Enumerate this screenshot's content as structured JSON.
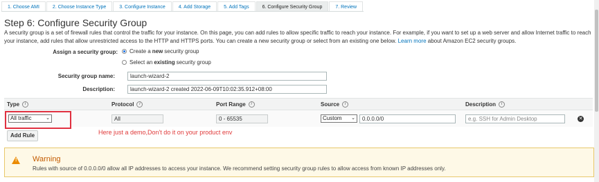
{
  "wizard_tabs": [
    {
      "label": "1. Choose AMI"
    },
    {
      "label": "2. Choose Instance Type"
    },
    {
      "label": "3. Configure Instance"
    },
    {
      "label": "4. Add Storage"
    },
    {
      "label": "5. Add Tags"
    },
    {
      "label": "6. Configure Security Group"
    },
    {
      "label": "7. Review"
    }
  ],
  "active_tab_index": 5,
  "step_title": "Step 6: Configure Security Group",
  "intro": {
    "text": "A security group is a set of firewall rules that control the traffic for your instance. On this page, you can add rules to allow specific traffic to reach your instance. For example, if you want to set up a web server and allow Internet traffic to reach your instance, add rules that allow unrestricted access to the HTTP and HTTPS ports. You can create a new security group or select from an existing one below.",
    "link": "Learn more",
    "suffix": "about Amazon EC2 security groups."
  },
  "assign": {
    "label": "Assign a security group:",
    "option_new_pre": "Create a",
    "option_new_bold": "new",
    "option_new_post": "security group",
    "option_existing_pre": "Select an",
    "option_existing_bold": "existing",
    "option_existing_post": "security group",
    "selected": "new"
  },
  "sg_name": {
    "label": "Security group name:",
    "value": "launch-wizard-2"
  },
  "description": {
    "label": "Description:",
    "value": "launch-wizard-2 created 2022-06-09T10:02:35.912+08:00"
  },
  "table": {
    "headers": {
      "type": "Type",
      "protocol": "Protocol",
      "port_range": "Port Range",
      "source": "Source",
      "description": "Description"
    },
    "info_glyph": "i",
    "rows": [
      {
        "type": "All traffic",
        "protocol": "All",
        "port_range": "0 - 65535",
        "source_mode": "Custom",
        "source_cidr": "0.0.0.0/0",
        "description_placeholder": "e.g. SSH for Admin Desktop"
      }
    ]
  },
  "annotation": "Here just a demo,Don't do it on your product env",
  "add_rule_label": "Add Rule",
  "warning": {
    "title": "Warning",
    "text": "Rules with source of 0.0.0.0/0 allow all IP addresses to access your instance. We recommend setting security group rules to allow access from known IP addresses only."
  },
  "colors": {
    "link": "#0073bb",
    "annotation_red": "#e03a3a",
    "warning_orange": "#eb8b00"
  },
  "icons": {
    "remove": "close-circle-icon",
    "warning": "warning-triangle-icon",
    "info": "info-icon",
    "chevron": "chevron-down-icon"
  }
}
